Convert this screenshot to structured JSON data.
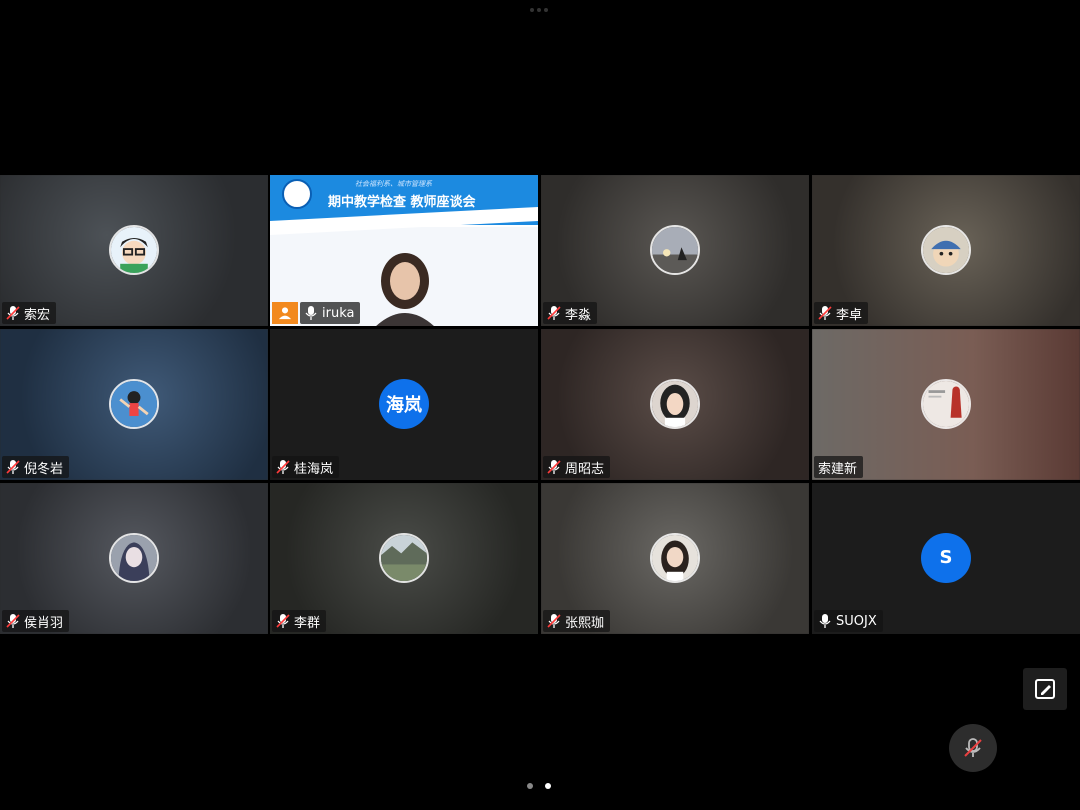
{
  "meeting": {
    "presenter": {
      "slide_subtitle": "社会福利系、城市管理系",
      "slide_title": "期中教学检查 教师座谈会",
      "name": "iruka"
    },
    "participants": [
      {
        "name": "索宏",
        "muted": true
      },
      {
        "name": "李淼",
        "muted": true
      },
      {
        "name": "李卓",
        "muted": true
      },
      {
        "name": "倪冬岩",
        "muted": true
      },
      {
        "name": "桂海岚",
        "muted": true,
        "avatar_text": "海岚"
      },
      {
        "name": "周昭志",
        "muted": true
      },
      {
        "name": "索建新",
        "muted": null
      },
      {
        "name": "侯肖羽",
        "muted": true
      },
      {
        "name": "李群",
        "muted": true
      },
      {
        "name": "张熙珈",
        "muted": true
      },
      {
        "name": "SUOJX",
        "muted": false,
        "avatar_text": "S"
      }
    ]
  },
  "controls": {
    "edit_icon": "pencil-square-icon",
    "mute_icon": "mic-muted-icon"
  },
  "pagination": {
    "pages": 2,
    "current": 2
  },
  "colors": {
    "accent": "#0e71eb",
    "presenter_badge": "#f2891e",
    "slide_blue": "#1c8ae0"
  }
}
